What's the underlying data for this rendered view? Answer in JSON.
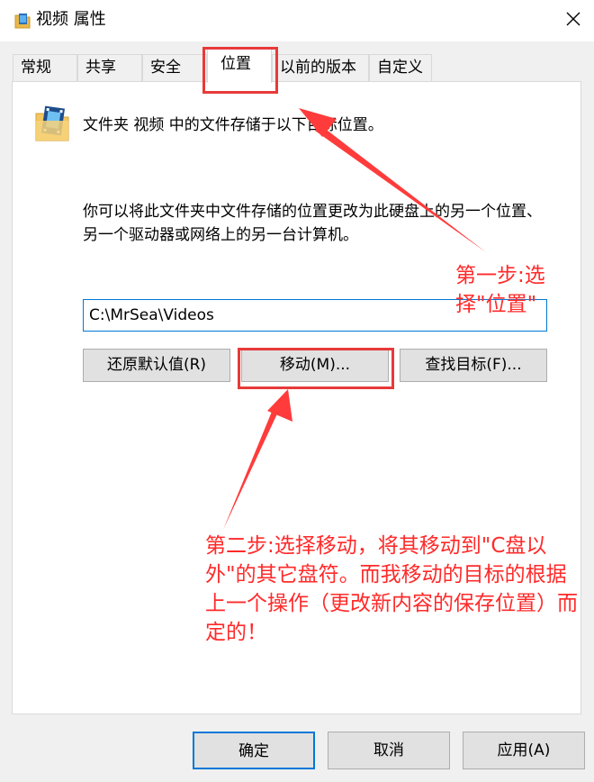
{
  "window": {
    "title": "视频 属性"
  },
  "tabs": [
    {
      "label": "常规"
    },
    {
      "label": "共享"
    },
    {
      "label": "安全"
    },
    {
      "label": "位置",
      "active": true
    },
    {
      "label": "以前的版本"
    },
    {
      "label": "自定义"
    }
  ],
  "location_page": {
    "folder_description": "文件夹 视频 中的文件存储于以下目标位置。",
    "explanation": "你可以将此文件夹中文件存储的位置更改为此硬盘上的另一个位置、另一个驱动器或网络上的另一台计算机。",
    "path_value": "C:\\MrSea\\Videos",
    "restore_default_label": "还原默认值(R)",
    "move_label": "移动(M)...",
    "find_target_label": "查找目标(F)..."
  },
  "footer": {
    "ok_label": "确定",
    "cancel_label": "取消",
    "apply_label": "应用(A)"
  },
  "annotations": {
    "step1": "第一步:选择\"位置\"",
    "step2": "第二步:选择移动，将其移动到\"C盘以外\"的其它盘符。而我移动的目标的根据上一个操作（更改新内容的保存位置）而定的！",
    "color": "#ff2a2a"
  },
  "colors": {
    "focus_blue": "#0078d7",
    "button_gray": "#e1e1e1",
    "dialog_bg": "#f0f0f0"
  },
  "icons": {
    "title": "folder-video-icon",
    "folder": "folder-video-icon",
    "close": "close-icon"
  }
}
